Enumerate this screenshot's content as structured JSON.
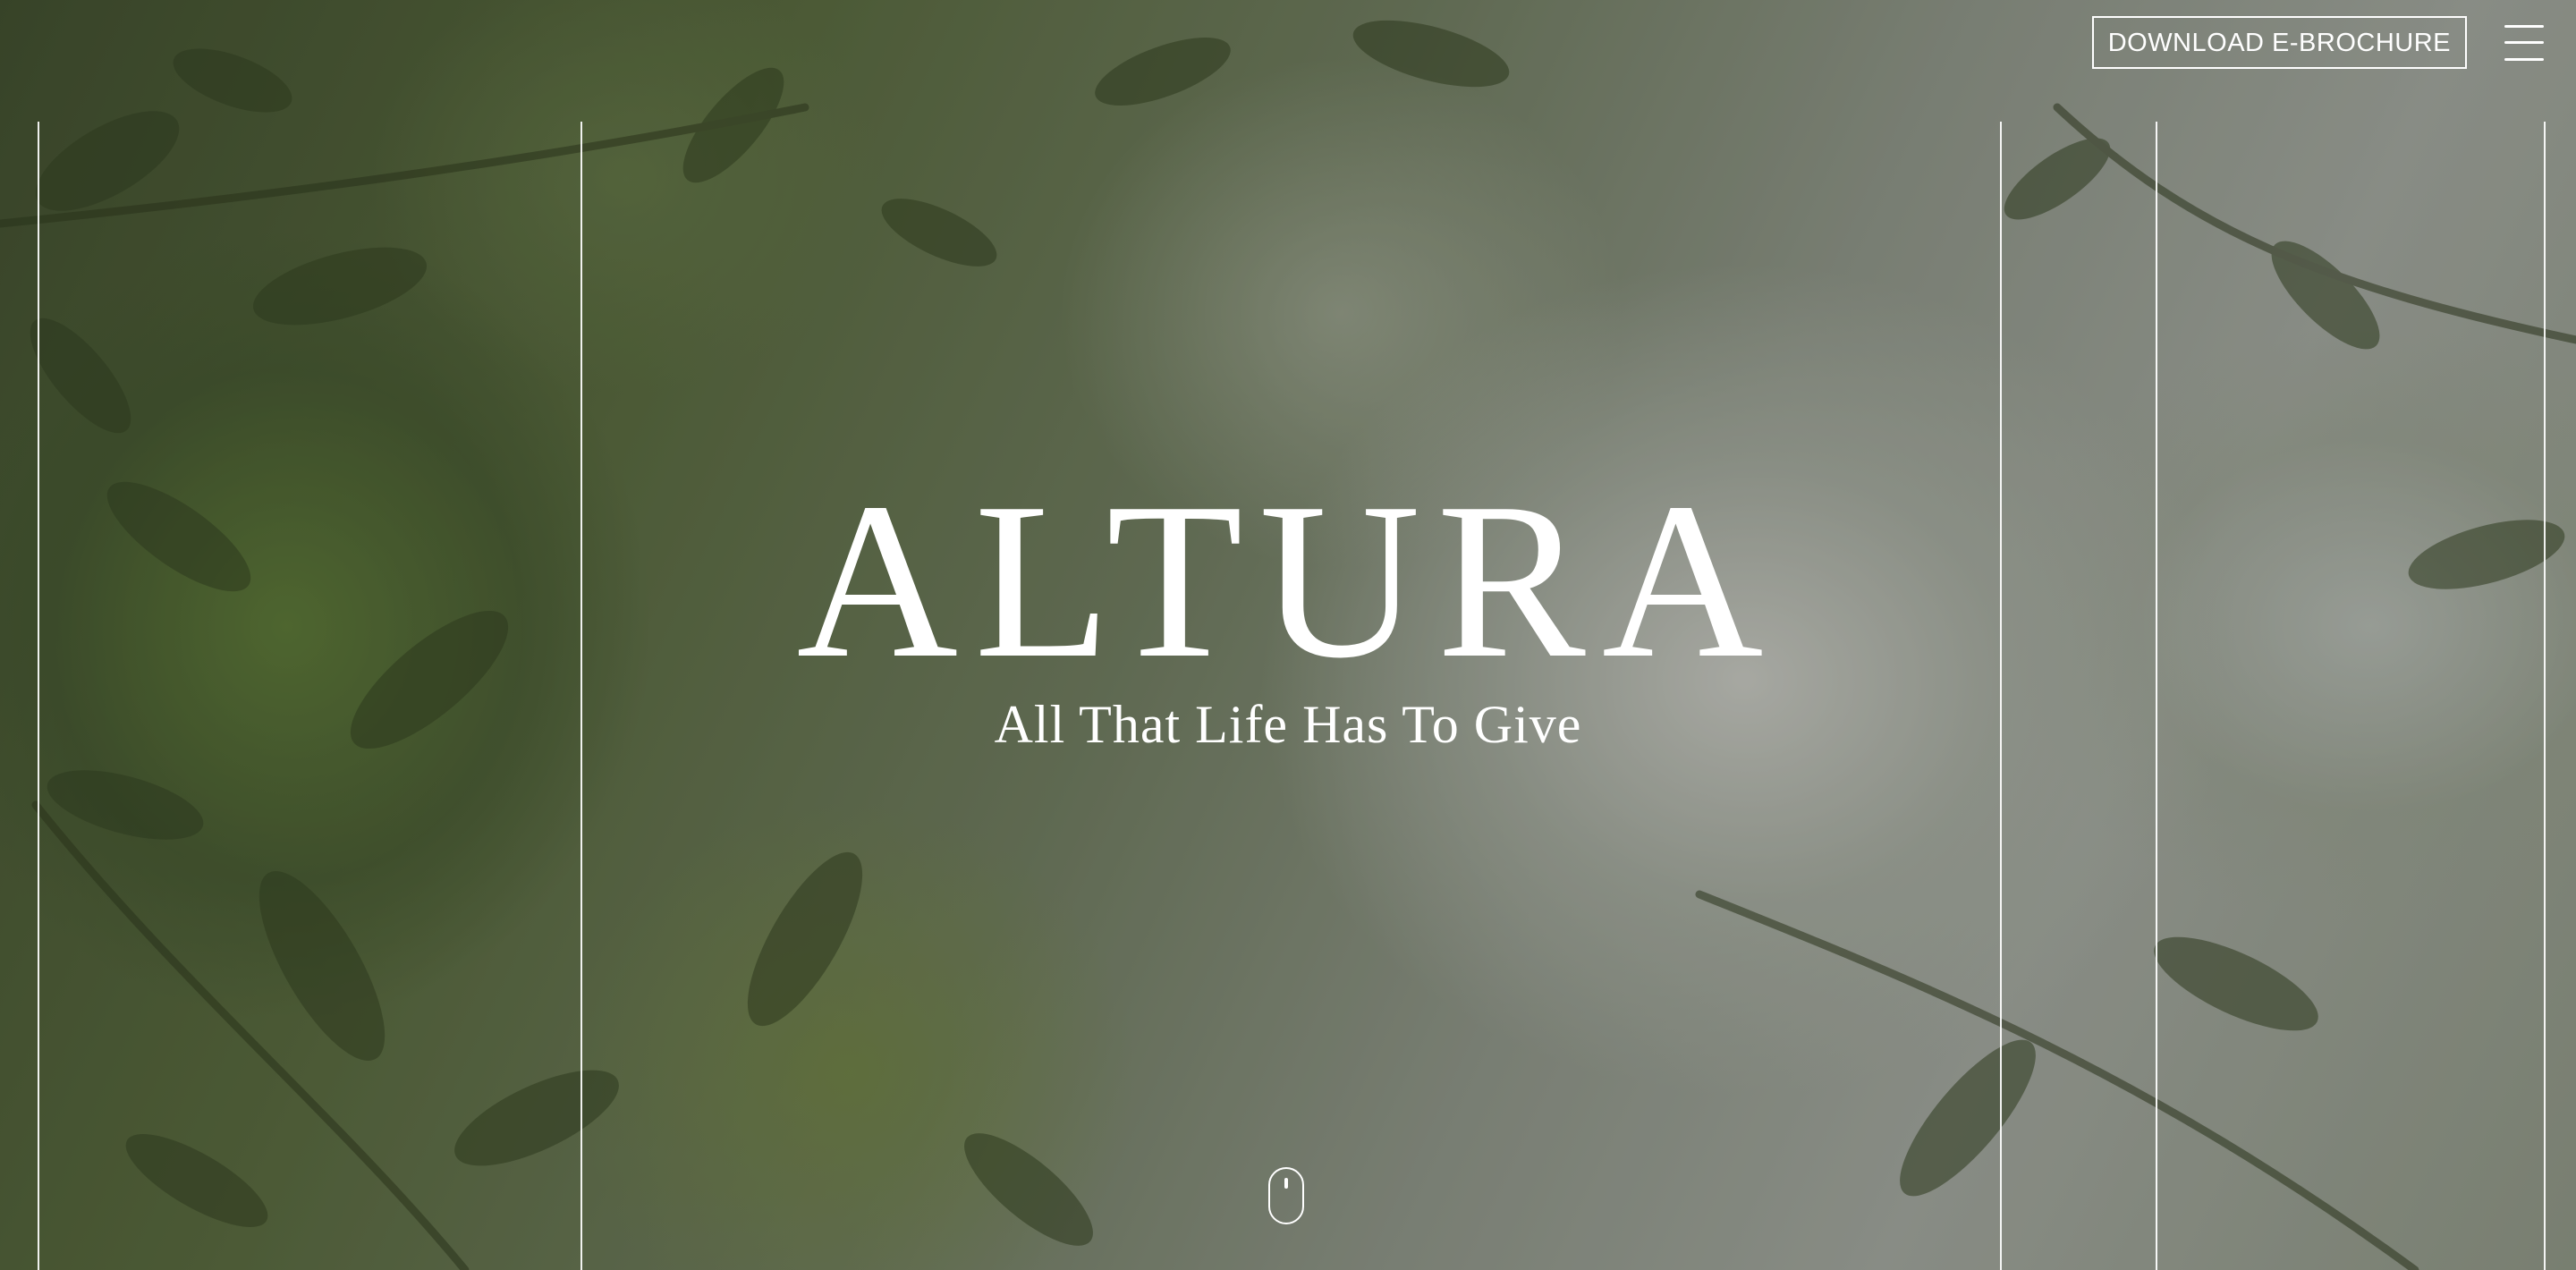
{
  "header": {
    "brochure_button_label": "DOWNLOAD E-BROCHURE",
    "menu_icon": "hamburger-menu-icon"
  },
  "hero": {
    "logo_text": "ALTURA",
    "tagline": "All That Life Has To Give",
    "scroll_icon": "mouse-scroll-icon",
    "background": "forest canopy video"
  },
  "colors": {
    "foreground": "#ffffff",
    "foliage_dark": "#3c4a2a",
    "mist": "#a3a7a0"
  }
}
